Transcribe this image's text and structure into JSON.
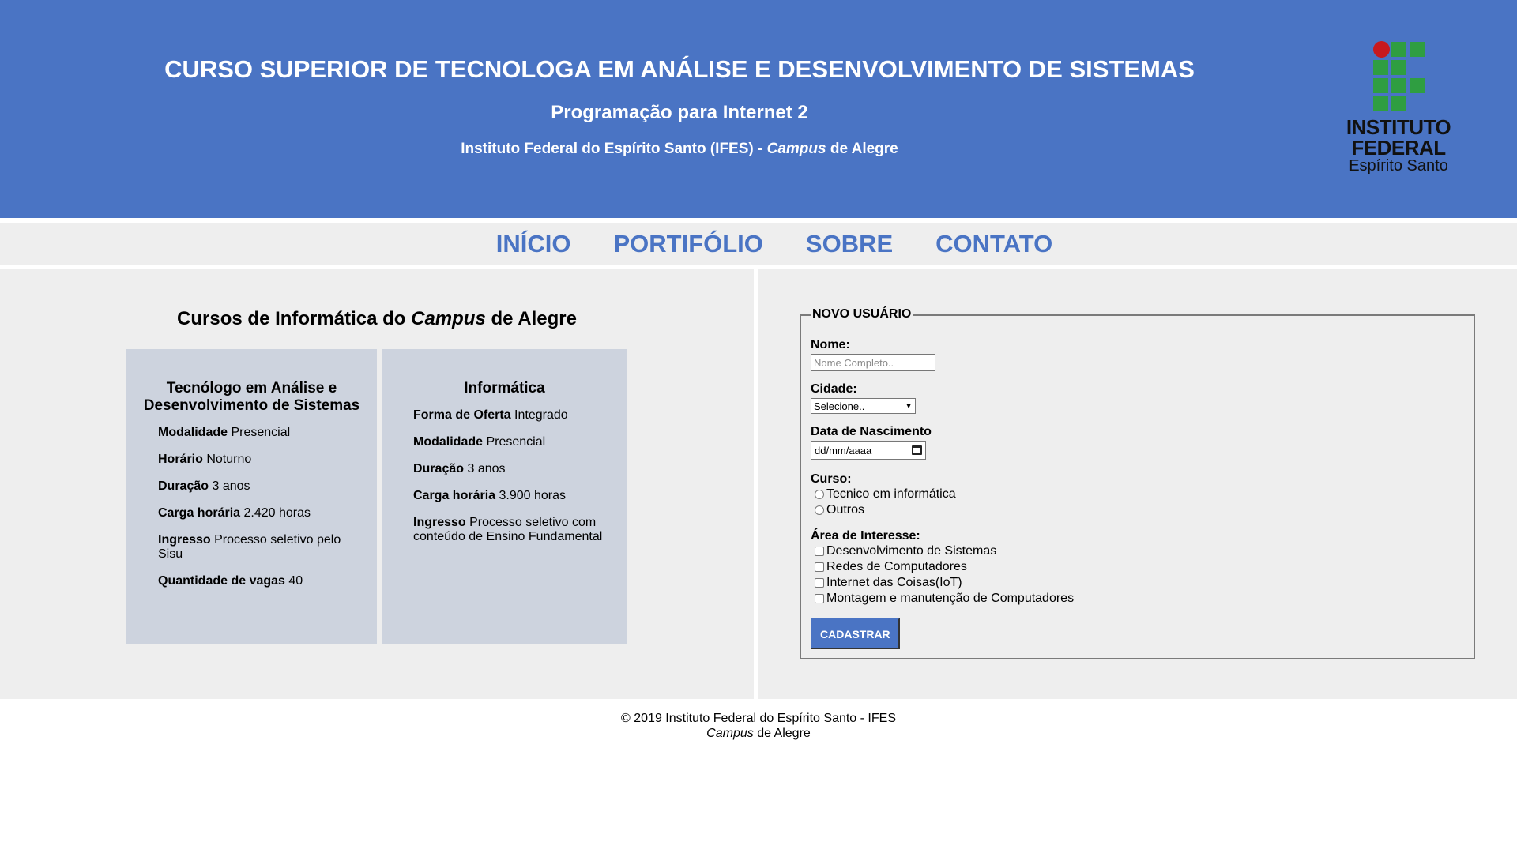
{
  "header": {
    "title": "CURSO SUPERIOR DE TECNOLOGA EM ANÁLISE E DESENVOLVIMENTO DE SISTEMAS",
    "subtitle": "Programação para Internet 2",
    "institution_prefix": "Instituto Federal do Espírito Santo (IFES) - ",
    "institution_campus": "Campus",
    "institution_suffix": " de Alegre",
    "logo": {
      "line1": "INSTITUTO",
      "line2": "FEDERAL",
      "line3": "Espírito Santo",
      "green": "#2f9e41",
      "red": "#c8191e"
    }
  },
  "nav": {
    "items": [
      "INÍCIO",
      "PORTIFÓLIO",
      "SOBRE",
      "CONTATO"
    ]
  },
  "courses": {
    "title_prefix": "Cursos de Informática do ",
    "title_campus": "Campus",
    "title_suffix": " de Alegre",
    "cards": [
      {
        "title": "Tecnólogo em Análise e Desenvolvimento de Sistemas",
        "rows": [
          {
            "label": "Modalidade",
            "value": " Presencial"
          },
          {
            "label": "Horário",
            "value": " Noturno"
          },
          {
            "label": "Duração",
            "value": " 3 anos"
          },
          {
            "label": "Carga horária",
            "value": " 2.420 horas"
          },
          {
            "label": "Ingresso",
            "value": " Processo seletivo pelo Sisu"
          },
          {
            "label": "Quantidade de vagas",
            "value": " 40"
          }
        ]
      },
      {
        "title": "Informática",
        "rows": [
          {
            "label": "Forma de Oferta",
            "value": " Integrado"
          },
          {
            "label": "Modalidade",
            "value": " Presencial"
          },
          {
            "label": "Duração",
            "value": " 3 anos"
          },
          {
            "label": "Carga horária",
            "value": " 3.900 horas"
          },
          {
            "label": "Ingresso",
            "value": " Processo seletivo com conteúdo de Ensino Fundamental"
          }
        ]
      }
    ]
  },
  "form": {
    "legend": "NOVO USUÁRIO",
    "name_label": "Nome:",
    "name_placeholder": "Nome Completo..",
    "city_label": "Cidade:",
    "city_selected": "Selecione..",
    "birth_label": "Data de Nascimento",
    "birth_placeholder": "dd/mm/aaaa",
    "course_label": "Curso:",
    "course_options": [
      "Tecnico em informática",
      "Outros"
    ],
    "interest_label": "Área de Interesse:",
    "interest_options": [
      "Desenvolvimento de Sistemas",
      "Redes de Computadores",
      "Internet das Coisas(IoT)",
      "Montagem e manutenção de Computadores"
    ],
    "submit_label": "CADASTRAR"
  },
  "footer": {
    "line1": "© 2019 Instituto Federal do Espírito Santo - IFES",
    "line2_campus": "Campus",
    "line2_suffix": " de Alegre"
  },
  "colors": {
    "accent": "#4a74c4",
    "panel": "#eeeeee",
    "card": "#cdd3de"
  }
}
